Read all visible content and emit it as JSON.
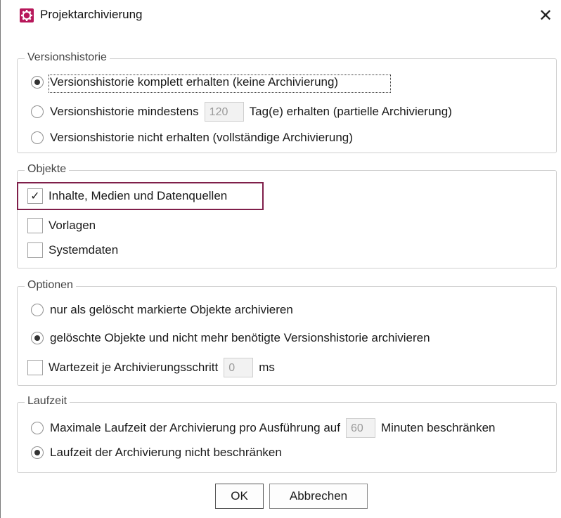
{
  "window": {
    "title": "Projektarchivierung",
    "close_glyph": "✕",
    "icon": "gear-icon"
  },
  "accent_color": "#b7175a",
  "highlight_color": "#7f1f4a",
  "versionshistorie": {
    "legend": "Versionshistorie",
    "option_full": "Versionshistorie komplett erhalten (keine Archivierung)",
    "option_partial_before": "Versionshistorie mindestens",
    "option_partial_days": "120",
    "option_partial_after": "Tag(e) erhalten (partielle Archivierung)",
    "option_none": "Versionshistorie nicht erhalten (vollständige Archivierung)",
    "selected": "option_full"
  },
  "objekte": {
    "legend": "Objekte",
    "items": [
      {
        "label": "Inhalte, Medien und Datenquellen",
        "checked": true
      },
      {
        "label": "Vorlagen",
        "checked": false
      },
      {
        "label": "Systemdaten",
        "checked": false
      }
    ],
    "check_glyph": "✓"
  },
  "optionen": {
    "legend": "Optionen",
    "option_marked": "nur als gelöscht markierte Objekte archivieren",
    "option_deleted": "gelöschte Objekte und nicht mehr benötigte Versionshistorie archivieren",
    "selected": "option_deleted",
    "wait_label": "Wartezeit je Archivierungsschritt",
    "wait_value": "0",
    "wait_unit": "ms",
    "wait_checked": false
  },
  "laufzeit": {
    "legend": "Laufzeit",
    "option_limit_before": "Maximale Laufzeit der Archivierung pro Ausführung auf",
    "option_limit_value": "60",
    "option_limit_after": "Minuten beschränken",
    "option_unlimited": "Laufzeit der Archivierung nicht beschränken",
    "selected": "option_unlimited"
  },
  "buttons": {
    "ok": "OK",
    "cancel": "Abbrechen"
  }
}
